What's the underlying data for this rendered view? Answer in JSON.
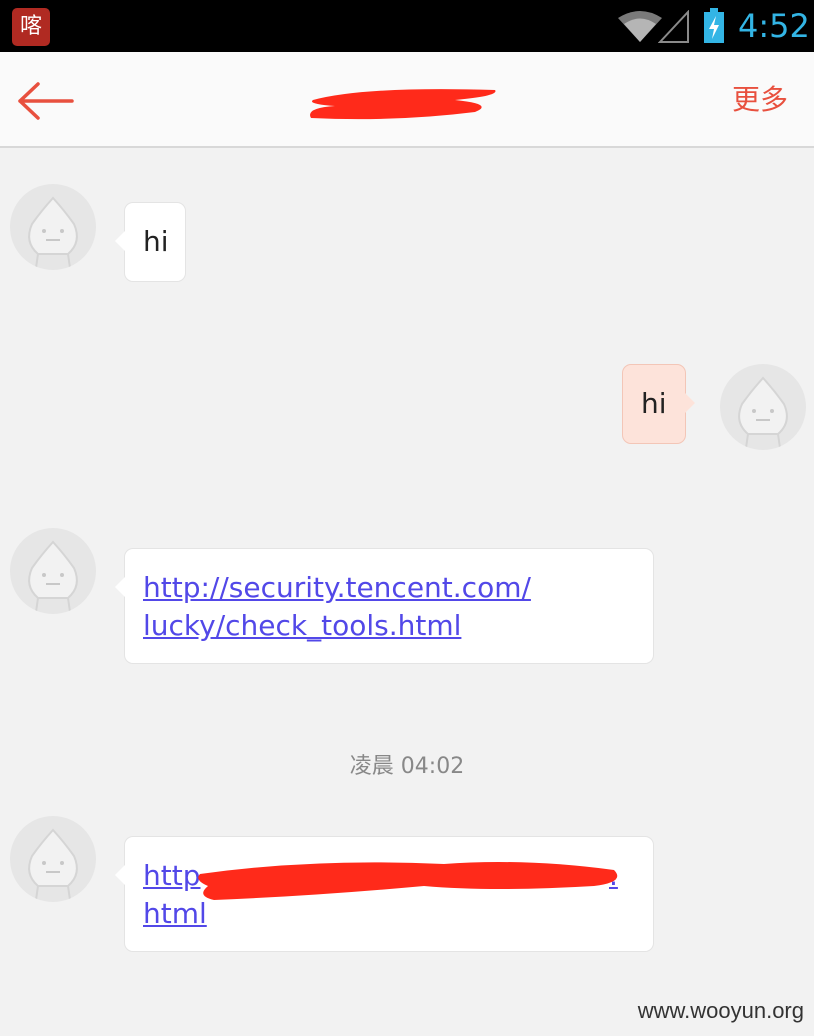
{
  "status_bar": {
    "app_badge_icon": "喀",
    "time": "4:52",
    "time_color": "#33b5e5"
  },
  "header": {
    "more_label": "更多",
    "accent_color": "#e8503e"
  },
  "messages": [
    {
      "direction": "in",
      "text": "hi"
    },
    {
      "direction": "out",
      "text": "hi"
    },
    {
      "direction": "in",
      "link_line1": "http://security.tencent.com/",
      "link_line2": "lucky/check_tools.html"
    },
    {
      "direction": "in",
      "link_line1": "http",
      "link_line1_end": ".",
      "link_line2": "html"
    }
  ],
  "timestamp": "凌晨 04:02",
  "watermark": "www.wooyun.org"
}
